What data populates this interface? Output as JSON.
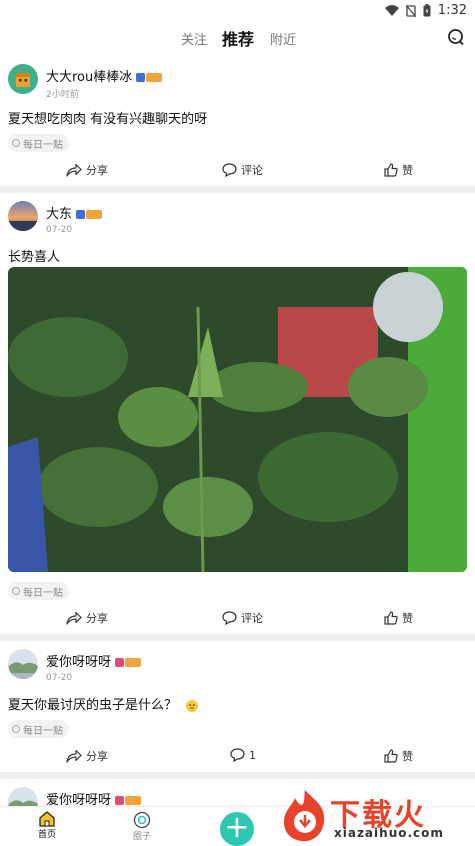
{
  "status": {
    "time": "1:32"
  },
  "topnav": {
    "tabs": [
      "关注",
      "推荐",
      "附近"
    ],
    "active": "推荐"
  },
  "posts": [
    {
      "username": "大大rou棒棒冰",
      "time": "2小时前",
      "content": "夏天想吃肉肉 有没有兴趣聊天的呀",
      "tag": "每日一贴",
      "share": "分享",
      "comment": "评论",
      "like": "赞"
    },
    {
      "username": "大东",
      "time": "07-20",
      "content": "长势喜人",
      "tag": "每日一贴",
      "share": "分享",
      "comment": "评论",
      "like": "赞"
    },
    {
      "username": "爱你呀呀呀",
      "time": "07-20",
      "content": "夏天你最讨厌的虫子是什么？",
      "tag": "每日一贴",
      "share": "分享",
      "comment": "1",
      "like": "赞"
    },
    {
      "username": "爱你呀呀呀"
    }
  ],
  "bottomnav": {
    "home": "首页",
    "circle": "圈子"
  },
  "watermark": {
    "brand": "下载火",
    "url": "xiazaihuo.com"
  },
  "colors": {
    "accent": "#2ec7b0",
    "badge_blue": "#3a6fd8",
    "badge_orange": "#f4a23a",
    "badge_pink": "#e24a7a"
  }
}
